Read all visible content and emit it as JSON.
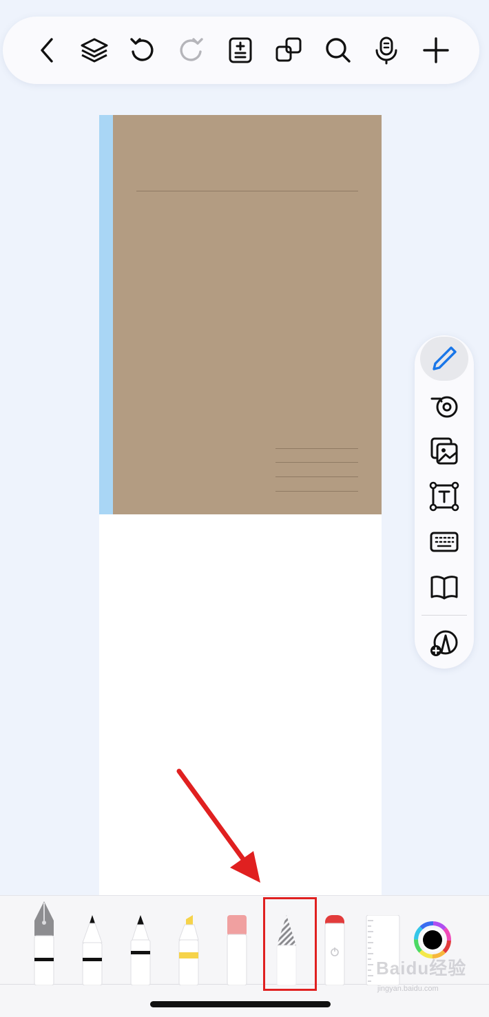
{
  "top_toolbar": {
    "buttons": [
      "back-icon",
      "layers-icon",
      "undo-icon",
      "redo-icon",
      "page-add-icon",
      "copy-icon",
      "search-icon",
      "microphone-icon",
      "add-icon"
    ]
  },
  "side_panel": {
    "tools": [
      "pen-icon",
      "tape-icon",
      "image-icon",
      "textbox-icon",
      "keyboard-icon",
      "book-icon",
      "shape-add-icon"
    ],
    "active": "pen-icon"
  },
  "bottom_tray": {
    "tools": [
      "fountain-pen",
      "ballpoint-pen",
      "fineliner",
      "highlighter",
      "eraser",
      "pencil",
      "lasso",
      "ruler",
      "color-picker"
    ],
    "selected": "pencil",
    "selected_color": "#000000"
  },
  "colors": {
    "cover": "#b39c82",
    "spine": "#a9d6f5",
    "highlight_annotation": "#e02020",
    "highlighter_yellow": "#f6d34a",
    "eraser_pink": "#f0a0a0",
    "lasso_red": "#e23b3b"
  },
  "watermark": {
    "logo": "Baidu经验",
    "url": "jingyan.baidu.com"
  }
}
